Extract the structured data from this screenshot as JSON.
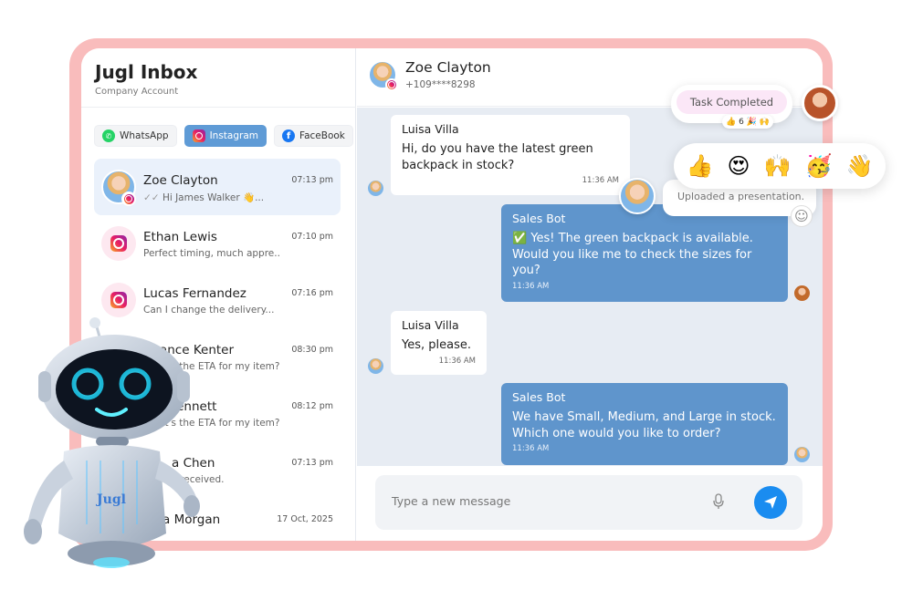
{
  "sidebar": {
    "title": "Jugl Inbox",
    "subtitle": "Company Account",
    "filters": [
      {
        "label": "WhatsApp",
        "icon": "whatsapp-icon"
      },
      {
        "label": "Instagram",
        "icon": "instagram-icon",
        "active": true
      },
      {
        "label": "FaceBook",
        "icon": "facebook-icon"
      }
    ],
    "conversations": [
      {
        "name": "Zoe Clayton",
        "preview": "Hi James Walker 👋...",
        "time": "07:13 pm"
      },
      {
        "name": "Ethan Lewis",
        "preview": "Perfect timing, much appre...",
        "time": "07:10 pm"
      },
      {
        "name": "Lucas Fernandez",
        "preview": "Can I change the delivery...",
        "time": "07:16 pm"
      },
      {
        "name": "Chance Kenter",
        "preview": "What's the ETA for my item?",
        "time": "08:30 pm"
      },
      {
        "name": "h Bennett",
        "preview": "What's the ETA for my item?",
        "time": "08:12 pm"
      },
      {
        "name": "a Chen",
        "preview": "tem received.",
        "time": "07:13 pm"
      },
      {
        "name": "a Morgan",
        "preview": "",
        "time": "17 Oct, 2025"
      }
    ]
  },
  "chat": {
    "contact_name": "Zoe Clayton",
    "contact_phone": "+109****8298",
    "messages": [
      {
        "sender": "Luisa Villa",
        "text": "Hi, do you have the latest green backpack in stock?",
        "time": "11:36 AM",
        "direction": "in"
      },
      {
        "sender": "Sales Bot",
        "text": "✅ Yes! The green backpack is available. Would you like me to check the sizes for you?",
        "time": "11:36 AM",
        "direction": "out"
      },
      {
        "sender": "Luisa Villa",
        "text": "Yes, please.",
        "time": "11:36 AM",
        "direction": "in"
      },
      {
        "sender": "Sales Bot",
        "text": "We have Small, Medium, and Large in stock. Which one would you like to order?",
        "time": "11:36 AM",
        "direction": "out"
      }
    ],
    "input_placeholder": "Type a new message"
  },
  "overlays": {
    "task_label": "Task Completed",
    "task_reactions": "👍 6 🎉 🙌",
    "emojis": [
      "👍",
      "😍",
      "🙌",
      "🥳",
      "👋"
    ],
    "upload_text": "Uploaded a presentation."
  },
  "robot": {
    "label": "Jugl"
  },
  "colors": {
    "frame": "#f9bcbc",
    "accent": "#5f95cc",
    "send_button": "#1a8cf0"
  }
}
